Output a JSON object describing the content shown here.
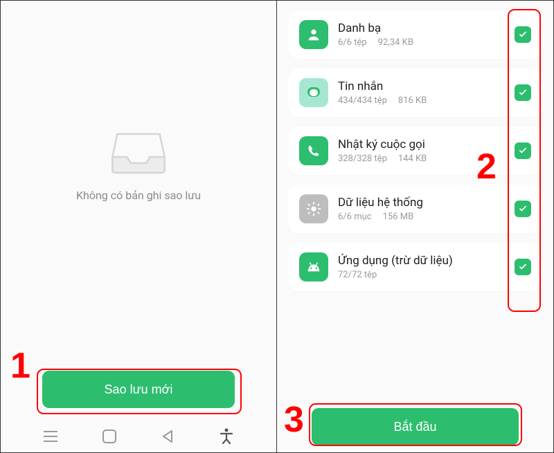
{
  "left": {
    "empty_text": "Không có bản ghi sao lưu",
    "button_label": "Sao lưu mới"
  },
  "right": {
    "button_label": "Bắt đầu"
  },
  "items": [
    {
      "title": "Danh bạ",
      "count": "6/6 tệp",
      "size": "92,34 KB",
      "icon": "contacts"
    },
    {
      "title": "Tin nhắn",
      "count": "434/434 tệp",
      "size": "816 KB",
      "icon": "messages"
    },
    {
      "title": "Nhật ký cuộc gọi",
      "count": "328/328 tệp",
      "size": "144 KB",
      "icon": "calls"
    },
    {
      "title": "Dữ liệu hệ thống",
      "count": "6/6 mục",
      "size": "156 MB",
      "icon": "system"
    },
    {
      "title": "Ứng dụng (trừ dữ liệu)",
      "count": "72/72 tệp",
      "size": "",
      "icon": "apps"
    }
  ],
  "annotations": {
    "n1": "1",
    "n2": "2",
    "n3": "3"
  }
}
